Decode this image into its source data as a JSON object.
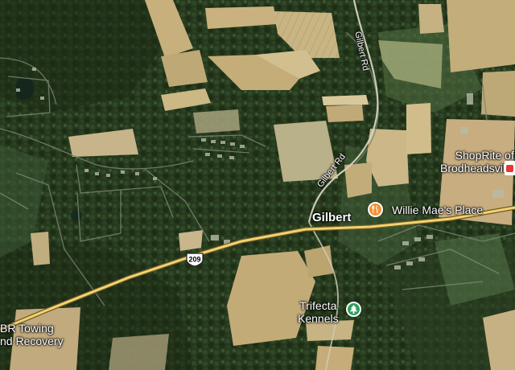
{
  "map": {
    "locality": "Gilbert",
    "roads": {
      "gilbert_rd_north": "Gilbert Rd",
      "gilbert_rd_south": "Gilbert Rd",
      "route_shield": "209"
    },
    "places": [
      {
        "id": "willie-maes",
        "text": "Willie Mae's Place",
        "category": "restaurant",
        "icon": "fork-knife-icon",
        "color": "#f29233"
      },
      {
        "id": "trifecta-kennels",
        "lines": [
          "Trifecta",
          "Kennels"
        ],
        "category": "park",
        "icon": "tree-icon",
        "color": "#2e9e5b"
      },
      {
        "id": "shoprite",
        "lines": [
          "ShopRite of",
          "Brodheadsville"
        ],
        "category": "store",
        "icon": "store-icon",
        "color": "#e53935"
      },
      {
        "id": "br-towing",
        "lines": [
          "BR Towing",
          "nd Recovery"
        ],
        "category": "business"
      }
    ]
  }
}
